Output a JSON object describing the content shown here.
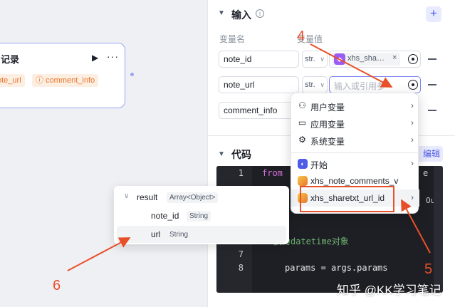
{
  "node": {
    "title": "记录",
    "tags": [
      "ote_url",
      "comment_info"
    ]
  },
  "input_section": {
    "title": "输入",
    "col_name": "变量名",
    "col_value": "变量值",
    "rows": [
      {
        "name": "note_id",
        "type": "str.",
        "value": "xhs_sha…",
        "ref_suffix": "·"
      },
      {
        "name": "note_url",
        "type": "str.",
        "placeholder": "输入或引用参"
      },
      {
        "name": "comment_info"
      }
    ]
  },
  "code_section": {
    "title": "代码",
    "edit_label": "编辑",
    "lines": [
      {
        "n": "1",
        "text": "from"
      },
      {
        "n": "7",
        "text": ""
      },
      {
        "n": "8",
        "text": "params = args.params"
      },
      {
        "n": "",
        "text": "换为datetime对象"
      }
    ],
    "right_fragment": "Out",
    "top_right_fragment": "e"
  },
  "dropdown": {
    "items": [
      {
        "label": "用户变量",
        "icon": "user-icon"
      },
      {
        "label": "应用变量",
        "icon": "folder-icon"
      },
      {
        "label": "系统变量",
        "icon": "gear-icon"
      },
      {
        "label": "开始",
        "icon": "start-icon"
      },
      {
        "label": "xhs_note_comments_v",
        "icon": "app-icon"
      },
      {
        "label": "xhs_sharetxt_url_id",
        "icon": "app-icon"
      }
    ]
  },
  "tree": {
    "root": {
      "label": "result",
      "type": "Array<Object>"
    },
    "children": [
      {
        "label": "note_id",
        "type": "String"
      },
      {
        "label": "url",
        "type": "String"
      }
    ]
  },
  "annotations": {
    "a4": "4",
    "a5": "5",
    "a6": "6"
  },
  "watermark": "知乎 @KK学习笔记",
  "colors": {
    "accent": "#4e5ae8",
    "annotation": "#e8502a",
    "tag": "#e8752e"
  }
}
